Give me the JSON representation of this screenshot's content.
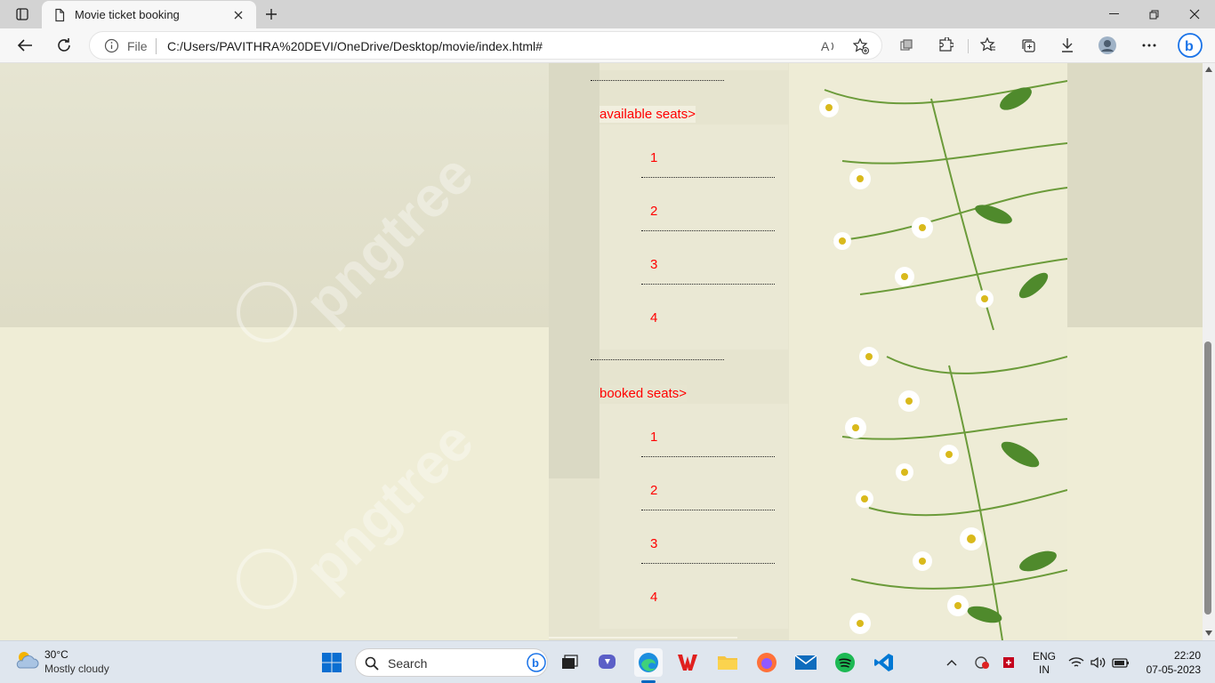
{
  "browser": {
    "tab_title": "Movie ticket booking",
    "address_file": "File",
    "address_url": "C:/Users/PAVITHRA%20DEVI/OneDrive/Desktop/movie/index.html#"
  },
  "page": {
    "available_heading": "available seats>",
    "available_seats": [
      "1",
      "2",
      "3",
      "4"
    ],
    "booked_heading": "booked seats>",
    "booked_seats": [
      "1",
      "2",
      "3",
      "4"
    ],
    "watermark": "pngtree"
  },
  "taskbar": {
    "weather_temp": "30°C",
    "weather_desc": "Mostly cloudy",
    "search_label": "Search",
    "lang_line1": "ENG",
    "lang_line2": "IN",
    "time": "22:20",
    "date": "07-05-2023"
  },
  "colors": {
    "seat_text": "#ff0000",
    "edge_accent": "#0067c0",
    "spotify": "#1db954"
  }
}
